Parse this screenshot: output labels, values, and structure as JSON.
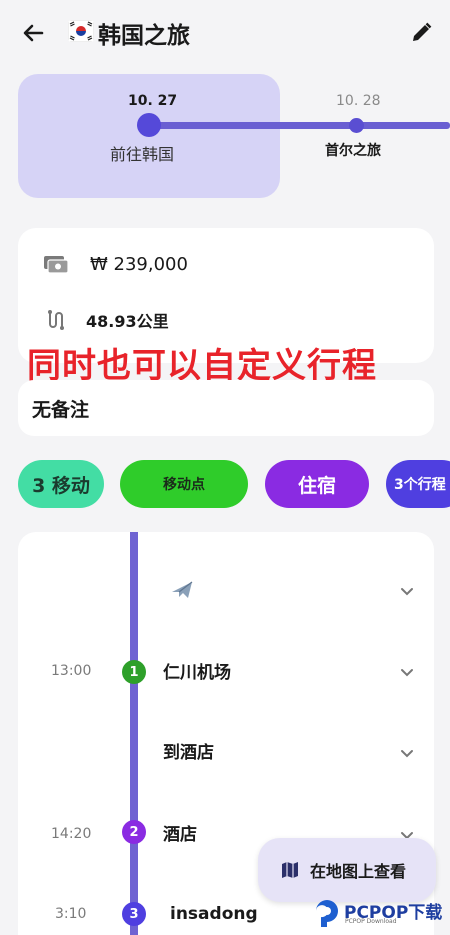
{
  "header": {
    "title": "韩国之旅",
    "back_icon": "arrow-left-icon",
    "flag_icon": "korea-flag-icon",
    "edit_icon": "pencil-icon"
  },
  "days": [
    {
      "date": "10. 27",
      "name": "前往韩国",
      "selected": true
    },
    {
      "date": "10. 28",
      "name": "首尔之旅",
      "selected": false
    }
  ],
  "info": {
    "cost": "₩ 239,000",
    "distance": "48.93公里",
    "money_icon": "money-icon",
    "route_icon": "route-icon"
  },
  "overlay_caption": "同时也可以自定义行程",
  "note": "无备注",
  "chips": {
    "move": "3 移动",
    "spot": "移动点",
    "stay": "住宿",
    "plan": "3个行程"
  },
  "schedule": [
    {
      "time": "",
      "name": "",
      "icon": "airplane-icon",
      "badge": ""
    },
    {
      "time": "13:00",
      "name": "仁川机场",
      "badge": "1"
    },
    {
      "time": "",
      "name": "到酒店",
      "badge": ""
    },
    {
      "time": "14:20",
      "name": "酒店",
      "badge": "2"
    },
    {
      "time": "3:10",
      "name": "insadong",
      "badge": "3"
    }
  ],
  "map_button": {
    "label": "在地图上查看",
    "icon": "map-icon"
  },
  "watermark": {
    "brand": "PCPOP下载",
    "sub": "PCPOP Download"
  },
  "colors": {
    "accent": "#5549d9",
    "selected_day_bg": "#d6d3f6",
    "chip_move": "#43dda4",
    "chip_spot": "#2fcc2a",
    "chip_stay": "#8a2be2",
    "chip_plan": "#4f3fe0",
    "overlay_red": "#e8232a"
  }
}
